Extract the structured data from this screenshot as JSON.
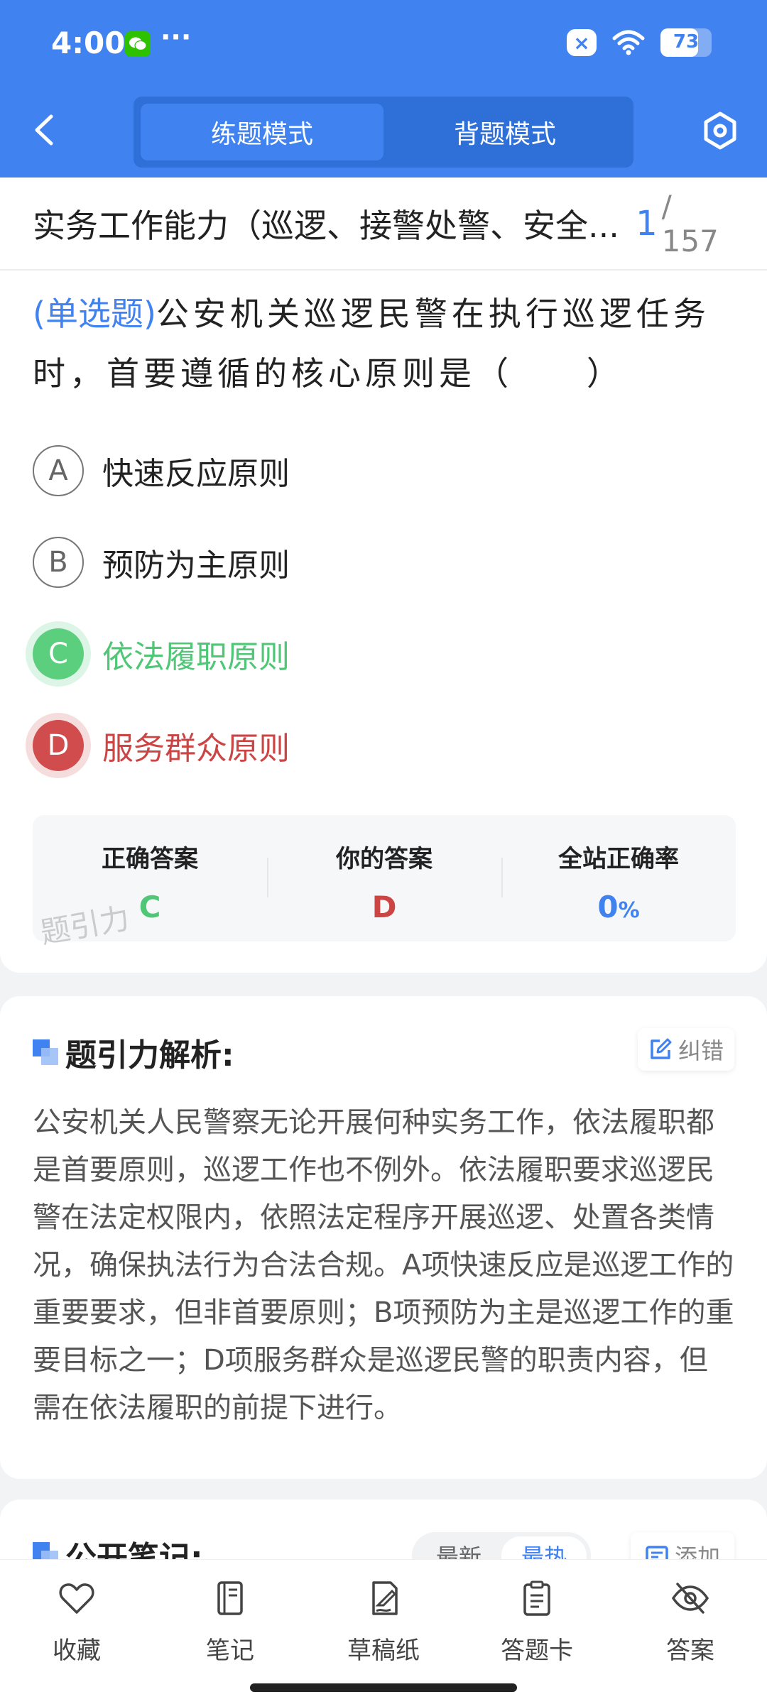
{
  "status_bar": {
    "time": "4:00",
    "battery": "73"
  },
  "header": {
    "tabs": [
      {
        "label": "练题模式",
        "active": true
      },
      {
        "label": "背题模式",
        "active": false
      }
    ]
  },
  "question": {
    "title": "实务工作能力（巡逻、接警处警、安全...",
    "current": "1",
    "total": "/ 157",
    "type": "(单选题)",
    "text": "公安机关巡逻民警在执行巡逻任务时，首要遵循的核心原则是（　　）",
    "options": [
      {
        "letter": "A",
        "text": "快速反应原则",
        "state": "normal"
      },
      {
        "letter": "B",
        "text": "预防为主原则",
        "state": "normal"
      },
      {
        "letter": "C",
        "text": "依法履职原则",
        "state": "correct"
      },
      {
        "letter": "D",
        "text": "服务群众原则",
        "state": "wrong"
      }
    ]
  },
  "stats": {
    "correct_label": "正确答案",
    "correct_value": "C",
    "yours_label": "你的答案",
    "yours_value": "D",
    "rate_label": "全站正确率",
    "rate_value": "0",
    "rate_unit": "%",
    "watermark": "题引力"
  },
  "analysis": {
    "title": "题引力解析:",
    "fix_label": "纠错",
    "text": "公安机关人民警察无论开展何种实务工作，依法履职都是首要原则，巡逻工作也不例外。依法履职要求巡逻民警在法定权限内，依照法定程序开展巡逻、处置各类情况，确保执法行为合法合规。A项快速反应是巡逻工作的重要要求，但非首要原则；B项预防为主是巡逻工作的重要目标之一；D项服务群众是巡逻民警的职责内容，但需在依法履职的前提下进行。"
  },
  "notes": {
    "title": "公开笔记:",
    "sort_new": "最新",
    "sort_hot": "最热",
    "add_label": "添加"
  },
  "bottom_nav": [
    {
      "label": "收藏",
      "icon": "heart-icon"
    },
    {
      "label": "笔记",
      "icon": "notebook-icon"
    },
    {
      "label": "草稿纸",
      "icon": "draft-icon"
    },
    {
      "label": "答题卡",
      "icon": "clipboard-icon"
    },
    {
      "label": "答案",
      "icon": "eye-off-icon"
    }
  ],
  "colors": {
    "primary": "#3f82f0",
    "correct": "#4fc776",
    "wrong": "#cc4545"
  }
}
